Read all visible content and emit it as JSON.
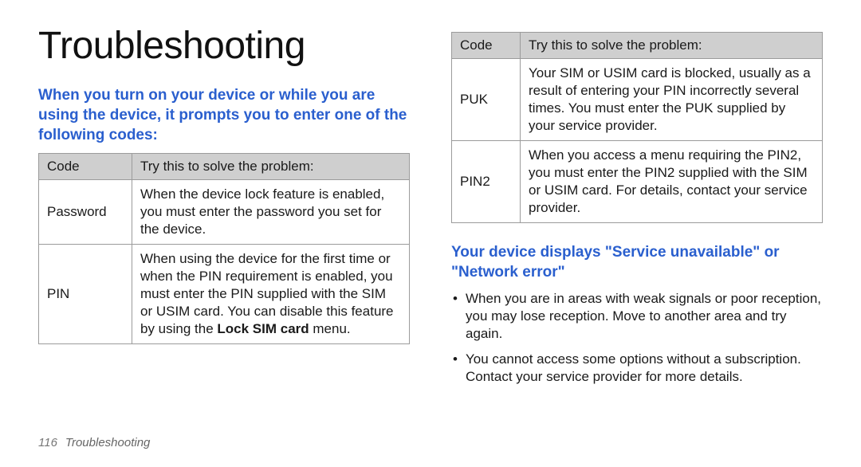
{
  "title": "Troubleshooting",
  "section1": {
    "heading": "When you turn on your device or while you are using the device, it prompts you to enter one of the following codes:",
    "th_code": "Code",
    "th_try": "Try this to solve the problem:",
    "rows": [
      {
        "code": "Password",
        "try": "When the device lock feature is enabled, you must enter the password you set for the device."
      },
      {
        "code": "PIN",
        "try_prefix": "When using the device for the first time or when the PIN requirement is enabled, you must enter the PIN supplied with the SIM or USIM card. You can disable this feature by using the ",
        "try_bold": "Lock SIM card",
        "try_suffix": " menu."
      }
    ]
  },
  "section1b": {
    "th_code": "Code",
    "th_try": "Try this to solve the problem:",
    "rows": [
      {
        "code": "PUK",
        "try": "Your SIM or USIM card is blocked, usually as a result of entering your PIN incorrectly several times. You must enter the PUK supplied by your service provider."
      },
      {
        "code": "PIN2",
        "try": "When you access a menu requiring the PIN2, you must enter the PIN2 supplied with the SIM or USIM card. For details, contact your service provider."
      }
    ]
  },
  "section2": {
    "heading": "Your device displays \"Service unavailable\" or \"Network error\"",
    "bullets": [
      "When you are in areas with weak signals or poor reception, you may lose reception. Move to another area and try again.",
      "You cannot access some options without a subscription. Contact your service provider for more details."
    ]
  },
  "footer": {
    "page_no": "116",
    "section": "Troubleshooting"
  }
}
